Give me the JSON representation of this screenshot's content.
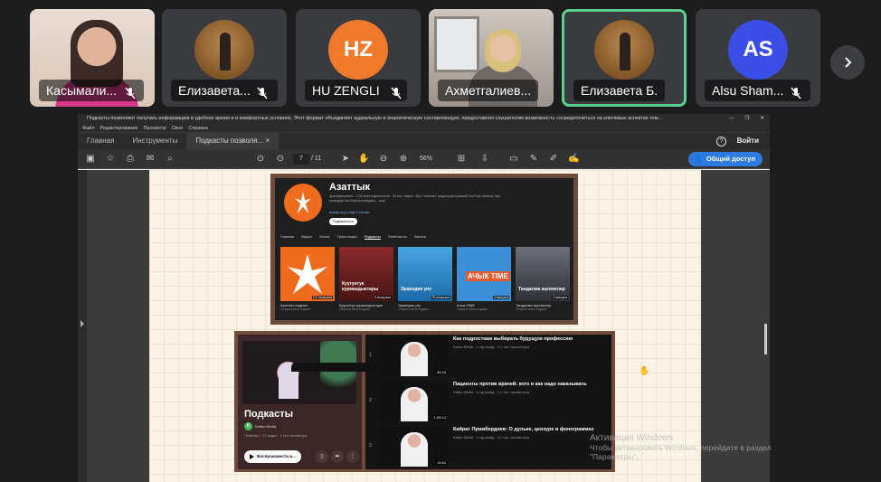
{
  "participants": [
    {
      "name": "Касымали...",
      "type": "video",
      "muted": true,
      "active": false
    },
    {
      "name": "Елизавета...",
      "type": "photo",
      "muted": true,
      "active": false
    },
    {
      "name": "HU ZENGLI",
      "type": "initials",
      "initials": "HZ",
      "color": "#f07a2b",
      "muted": true,
      "active": false
    },
    {
      "name": "Ахметгалиев...",
      "type": "video",
      "muted": false,
      "active": false
    },
    {
      "name": "Елизавета Б.",
      "type": "photo",
      "muted": false,
      "active": true
    },
    {
      "name": "Alsu Sham...",
      "type": "initials",
      "initials": "AS",
      "color": "#3a4ee6",
      "muted": true,
      "active": false
    }
  ],
  "next_icon": "chevron-right-icon",
  "acrobat": {
    "window_title": "Подкасты позволяют получать информацию в удобное время и в комфортных условиях. Этот формат объединяет аудиальную и аналитическую составляющую, предоставляя слушателям возможность сосредоточиться на ключевых аспектах тем...",
    "menu": [
      "Файл",
      "Редактирование",
      "Просмотр",
      "Окно",
      "Справка"
    ],
    "tabs": [
      "Главная",
      "Инструменты",
      "Подкасты позволя..."
    ],
    "tab_close": "×",
    "login": "Войти",
    "help": "?",
    "page_current": "7",
    "page_total": "/ 11",
    "zoom": "56%",
    "share_label": "Общий доступ"
  },
  "azattyk": {
    "title": "Азаттык",
    "meta": "@azattykradiosu · 3,03 млн подписчиков · 20 тыс. видео · Бул \"Азаттык\" радиосунун расмий YouTube каналы. Бул каналдан биз Кыргызстандагы ...ещё",
    "link": "azattyk.org и ещё 1 ссылка",
    "subscribe": "Подписаться",
    "nav": [
      "Главная",
      "Видео",
      "Shorts",
      "Трансляции",
      "Подкасты",
      "Плейлисты",
      "Записи"
    ],
    "nav_active": "Подкасты",
    "thumbs": [
      {
        "label": "Азаттык подкаст",
        "sub": "Открыть весь подкаст",
        "color": "#ef6b1d",
        "text": "",
        "count": "137 выпусков"
      },
      {
        "label": "Куугунтук курмандыктары",
        "sub": "Открыть весь подкаст",
        "color": "#7a2424",
        "text": "Куугунтук курмандыктары",
        "count": "8 выпусков"
      },
      {
        "label": "Эркиндик үнү",
        "sub": "Открыть весь подкаст",
        "color": "#2b8ad0",
        "text": "Эркиндик үнү",
        "count": "25 выпусков"
      },
      {
        "label": "Ачык TIME",
        "sub": "Открыть весь подкаст",
        "color": "#3a8fd6",
        "text": "АЧЫК TIME",
        "count": "4 выпуска"
      },
      {
        "label": "Тандалма аңгемелер",
        "sub": "Открыть весь подкаст",
        "color": "#3a3d44",
        "text": "Тандалма аңгемелер",
        "count": "3 выпуска"
      }
    ]
  },
  "podcast": {
    "title": "Подкасты",
    "channel": "Kaitsu Media",
    "channel_initial": "K",
    "meta": "Плейлист · 72 видео · 1 244 просмотра",
    "play_all": "Воспроизвести в...",
    "videos": [
      {
        "num": "1",
        "title": "Как подросткам выбирать будущую профессию",
        "meta": "Kaitsu Media · 1 год назад · 3,1 тыс. просмотров",
        "duration": "38:15"
      },
      {
        "num": "2",
        "title": "Пациенты против врачей: кого и как надо наказывать",
        "meta": "Kaitsu Media · 1 год назад · 1,1 тыс. просмотров",
        "duration": "1:05:12"
      },
      {
        "num": "3",
        "title": "Кайрат Примбердиев: О дульке, цензуре и фонограммах",
        "meta": "Kaitsu Media · 1 год назад · 3,1 тыс. просмотров",
        "duration": "19:42"
      }
    ]
  },
  "watermark": {
    "line1": "Активация Windows",
    "line2": "Чтобы активировать Windows, перейдите в раздел",
    "line3": "\"Параметры\"."
  }
}
